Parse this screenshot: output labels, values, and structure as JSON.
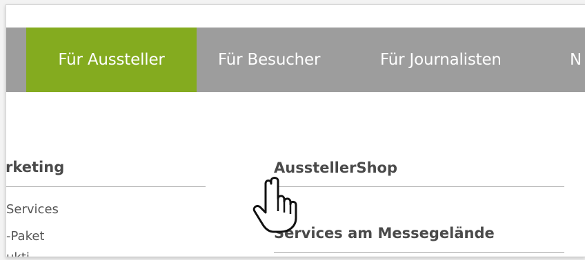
{
  "nav": {
    "items": [
      {
        "label": "Für Aussteller",
        "active": true
      },
      {
        "label": "Für Besucher",
        "active": false
      },
      {
        "label": "Für Journalisten",
        "active": false
      },
      {
        "label": "N",
        "active": false
      }
    ]
  },
  "menu": {
    "left_heading": "rketing",
    "left_links": [
      "Services",
      "-Paket",
      "ukti"
    ],
    "right_heading_1": "AusstellerShop",
    "right_heading_2": "Services am Messegelände"
  },
  "colors": {
    "nav_bg": "#9d9d9d",
    "active_bg": "#84ab1f",
    "text_dark": "#4a4a4a"
  },
  "icons": {
    "cursor": "hand-pointer-icon"
  }
}
